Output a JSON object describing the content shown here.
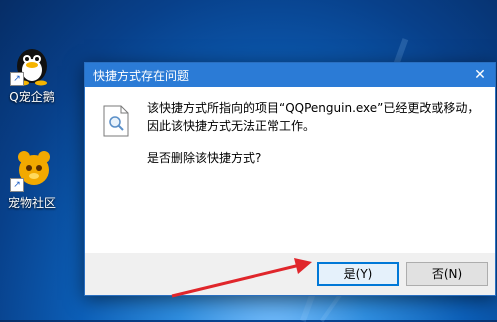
{
  "desktop": {
    "icons": [
      {
        "label": "Q宠企鹅",
        "icon": "qq-penguin-icon"
      },
      {
        "label": "宠物社区",
        "icon": "pet-community-icon"
      }
    ]
  },
  "dialog": {
    "title": "快捷方式存在问题",
    "close_glyph": "✕",
    "message": "该快捷方式所指向的项目“QQPenguin.exe”已经更改或移动，因此该快捷方式无法正常工作。",
    "question": "是否删除该快捷方式?",
    "yes_label": "是(Y)",
    "no_label": "否(N)"
  },
  "colors": {
    "titlebar": "#2b7bd6",
    "arrow": "#e0262b",
    "default_button_border": "#0078d7"
  }
}
